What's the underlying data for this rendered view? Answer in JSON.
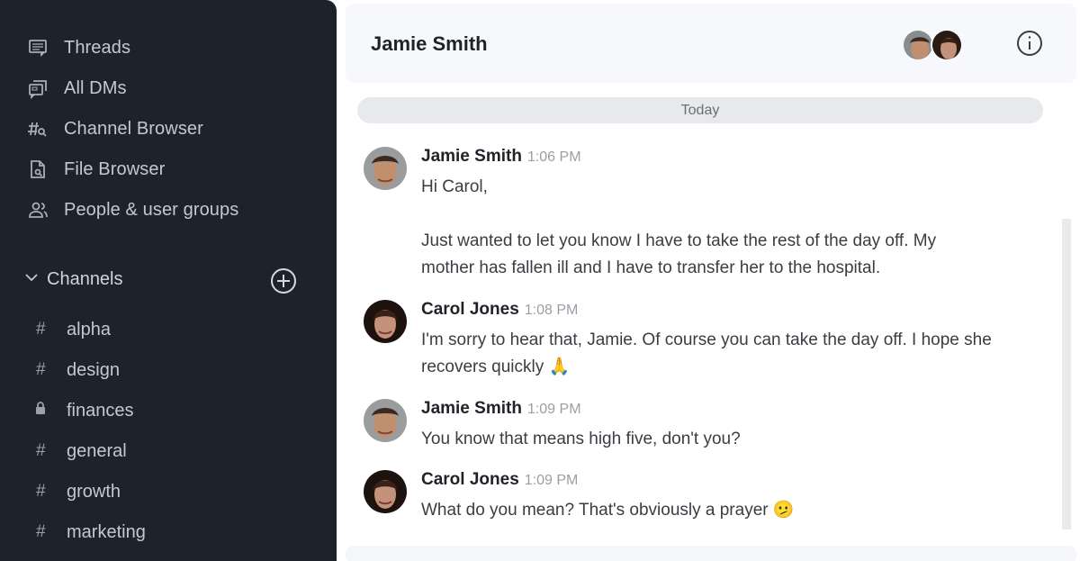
{
  "sidebar": {
    "nav": [
      {
        "label": "Threads",
        "icon": "threads-icon"
      },
      {
        "label": "All DMs",
        "icon": "all-dms-icon"
      },
      {
        "label": "Channel Browser",
        "icon": "channel-browser-icon"
      },
      {
        "label": "File Browser",
        "icon": "file-browser-icon"
      },
      {
        "label": "People & user groups",
        "icon": "people-icon"
      }
    ],
    "channels_header": "Channels",
    "channels": [
      {
        "name": "alpha",
        "type": "public",
        "glyph": "#"
      },
      {
        "name": "design",
        "type": "public",
        "glyph": "#"
      },
      {
        "name": "finances",
        "type": "private",
        "glyph": "lock"
      },
      {
        "name": "general",
        "type": "public",
        "glyph": "#"
      },
      {
        "name": "growth",
        "type": "public",
        "glyph": "#"
      },
      {
        "name": "marketing",
        "type": "public",
        "glyph": "#"
      }
    ]
  },
  "header": {
    "title": "Jamie Smith",
    "participants": [
      "Jamie Smith",
      "Carol Jones"
    ]
  },
  "date_divider": "Today",
  "messages": [
    {
      "author": "Jamie Smith",
      "time": "1:06 PM",
      "lines": [
        "Hi Carol,",
        "",
        "Just wanted to let you know I have to take the rest of the day off. My",
        "mother has fallen ill and I have to transfer her to the hospital."
      ]
    },
    {
      "author": "Carol Jones",
      "time": "1:08 PM",
      "lines": [
        "I'm sorry to hear that, Jamie. Of course you can take the day off. I hope she",
        "recovers quickly 🙏"
      ]
    },
    {
      "author": "Jamie Smith",
      "time": "1:09 PM",
      "lines": [
        "You know that means high five, don't you?"
      ]
    },
    {
      "author": "Carol Jones",
      "time": "1:09 PM",
      "lines": [
        "What do you mean? That's obviously a prayer 🫤"
      ]
    }
  ],
  "colors": {
    "sidebar_bg": "#1c232b",
    "header_bg": "#f6f8fb",
    "divider_bg": "#e7e9ec"
  }
}
